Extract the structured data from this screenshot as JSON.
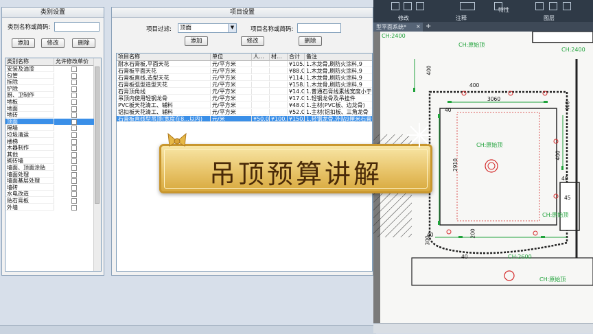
{
  "category_panel": {
    "title": "类别设置",
    "name_label": "类别名称或简码:",
    "add": "添加",
    "edit": "修改",
    "delete": "删除",
    "col_name": "类别名称",
    "col_allow": "允许修改单价",
    "items": [
      "安装及油漆",
      "包管",
      "拆除",
      "铲除",
      "厨、卫制作",
      "地板",
      "地面",
      "地砖",
      "顶面",
      "隔墙",
      "垃圾清运",
      "楼梯",
      "木器制作",
      "其他",
      "砌砖墙",
      "墙面、顶面涂贴",
      "墙面处理",
      "墙面基层处理",
      "墙砖",
      "水电改造",
      "贴石膏板",
      "外墙"
    ],
    "selected_index": 8
  },
  "item_panel": {
    "title": "项目设置",
    "filter_label": "项目过滤:",
    "filter_value": "顶面",
    "name_label": "项目名称或简码:",
    "add": "添加",
    "edit": "修改",
    "delete": "删除",
    "columns": [
      "项目名称",
      "单位",
      "人...",
      "材...",
      "合计",
      "备注"
    ],
    "rows": [
      [
        "耐水石膏板,平面天花",
        "元/平方米",
        "",
        "",
        "¥105.",
        "1.木龙骨,刷防火涂料,9"
      ],
      [
        "石膏板平面天花",
        "元/平方米",
        "",
        "",
        "¥88.C",
        "1.木龙骨,刷防火涂料,9"
      ],
      [
        "石膏板直线,造型天花",
        "元/平方米",
        "",
        "",
        "¥114.",
        "1.木龙骨,刷防火涂料,9"
      ],
      [
        "石膏板弧型造型天花",
        "元/平方米",
        "",
        "",
        "¥158.",
        "1.木龙骨,刷防火涂料,9"
      ],
      [
        "石膏顶角线",
        "元/平方米",
        "",
        "",
        "¥14.C",
        "1.普通石膏线素线宽度小于"
      ],
      [
        "吊顶内使用轻钢龙骨",
        "元/平方米",
        "",
        "",
        "¥17.C",
        "1.轻钢龙骨及吊挂件"
      ],
      [
        "PVC板天花清工、辅料",
        "元/平方米",
        "",
        "",
        "¥48.C",
        "1.主材(PVC板、边龙骨)"
      ],
      [
        "铝扣板天花清工、辅料",
        "元/平方米",
        "",
        "",
        "¥52.C",
        "1.主材(铝扣板、三角龙骨"
      ],
      [
        "石膏板直线型吊顶(宽度在8...以内)",
        "元/米",
        "¥50.0",
        "¥100.",
        "¥150.",
        "1.轻钢龙骨,外贴9厘米石膏"
      ]
    ],
    "selected_index": 8
  },
  "banner": {
    "text": "吊顶预算讲解"
  },
  "cad": {
    "ribbon_groups": [
      "修改",
      "注释",
      "图层"
    ],
    "ribbon_props": "特性",
    "tab_label": "型平面系统*",
    "tags": {
      "ch2400_a": "CH:2400",
      "ch2400_b": "CH:2400",
      "yuanshi_a": "CH:原始顶",
      "yuanshi_b": "CH:原始顶",
      "yuanshi_c": "CH:原始顶",
      "yuanshi_d": "CH:原始顶",
      "ch2600": "CH:2600",
      "dim_3060": "3060",
      "dim_2910": "2910",
      "dim_400a": "400",
      "dim_400b": "400",
      "dim_400c": "400",
      "dim_300": "300",
      "dim_40a": "40",
      "dim_40b": "40",
      "dim_40c": "40",
      "dim_40d": "40",
      "dim_45": "45",
      "dim_200": "200",
      "dim_400_top": "400"
    }
  },
  "colors": {
    "selection": "#3a8fe8",
    "cad_green": "#1fa23a",
    "cad_red": "#d42a2a",
    "banner_gold": "#e8c46a"
  }
}
